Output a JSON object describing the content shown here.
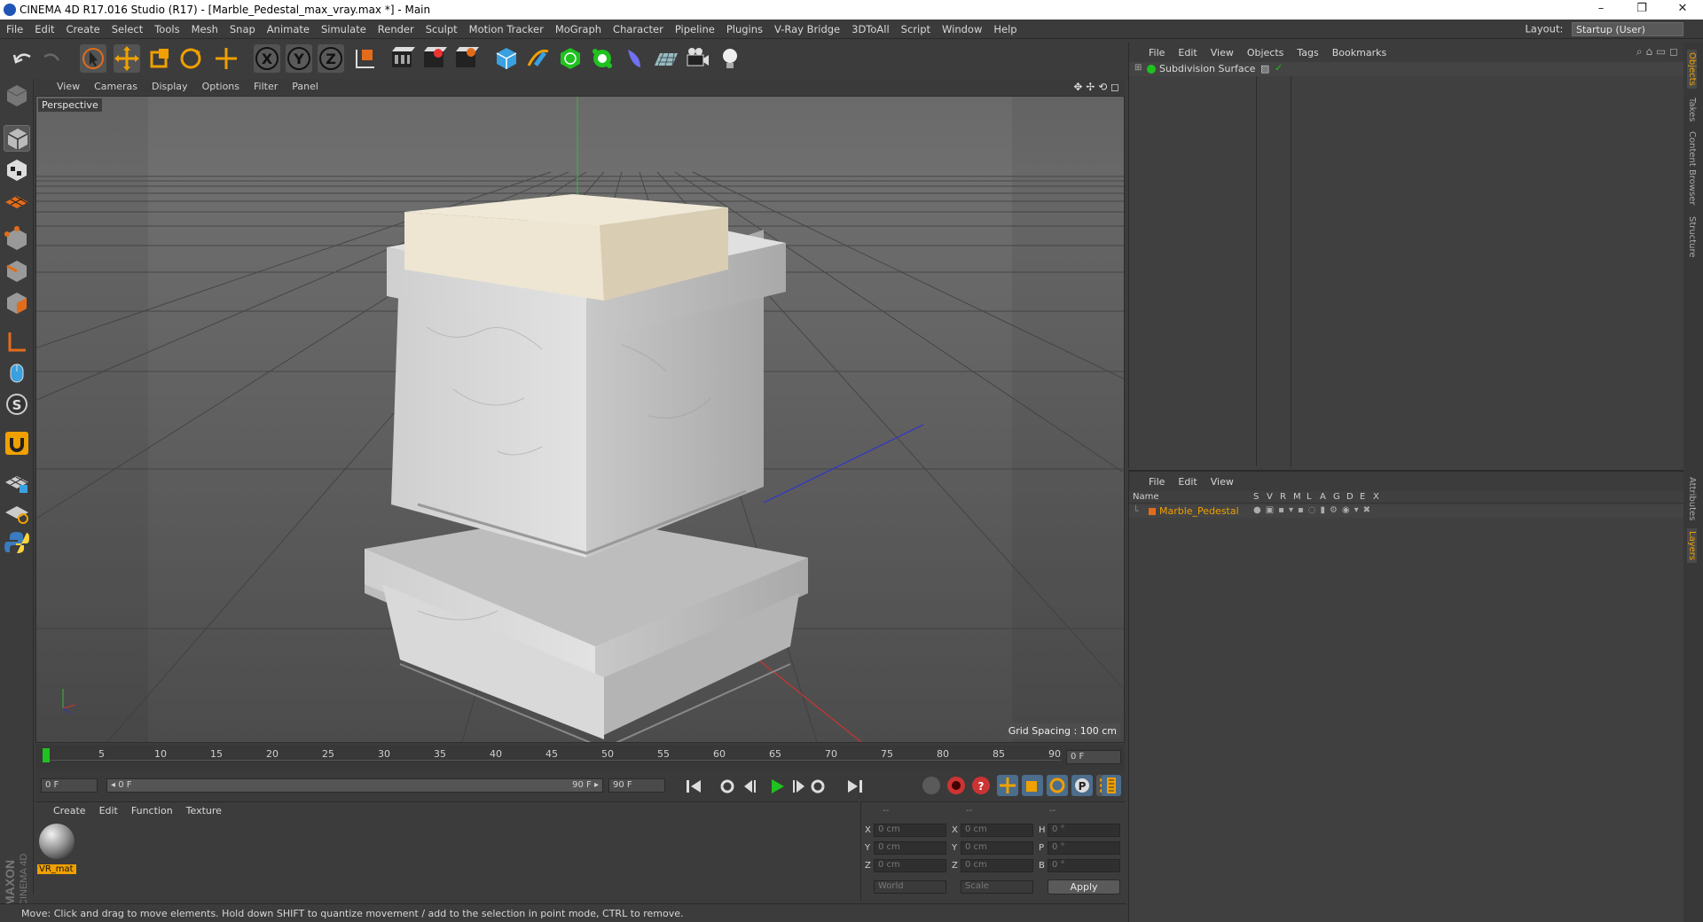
{
  "window": {
    "title": "CINEMA 4D R17.016 Studio (R17) - [Marble_Pedestal_max_vray.max *] - Main",
    "minimize": "–",
    "maximize": "❐",
    "close": "✕"
  },
  "menu": [
    "File",
    "Edit",
    "Create",
    "Select",
    "Tools",
    "Mesh",
    "Snap",
    "Animate",
    "Simulate",
    "Render",
    "Sculpt",
    "Motion Tracker",
    "MoGraph",
    "Character",
    "Pipeline",
    "Plugins",
    "V-Ray Bridge",
    "3DToAll",
    "Script",
    "Window",
    "Help"
  ],
  "layout": {
    "label": "Layout:",
    "value": "Startup (User)"
  },
  "viewport": {
    "menu": [
      "View",
      "Cameras",
      "Display",
      "Options",
      "Filter",
      "Panel"
    ],
    "camera_label": "Perspective",
    "grid_spacing": "Grid Spacing : 100 cm"
  },
  "timeline": {
    "ticks": [
      "0",
      "5",
      "10",
      "15",
      "20",
      "25",
      "30",
      "35",
      "40",
      "45",
      "50",
      "55",
      "60",
      "65",
      "70",
      "75",
      "80",
      "85",
      "90"
    ],
    "current_frame": "0 F",
    "start_field": "0 F",
    "range_start": "◂ 0 F",
    "range_end": "90 F ▸",
    "end_field": "90 F"
  },
  "material_manager": {
    "menu": [
      "Create",
      "Edit",
      "Function",
      "Texture"
    ],
    "material_name": "VR_mat"
  },
  "coordinates": {
    "headers": [
      "--",
      "--",
      "--"
    ],
    "rows": [
      {
        "a": "X",
        "av": "0 cm",
        "b": "X",
        "bv": "0 cm",
        "c": "H",
        "cv": "0 °"
      },
      {
        "a": "Y",
        "av": "0 cm",
        "b": "Y",
        "bv": "0 cm",
        "c": "P",
        "cv": "0 °"
      },
      {
        "a": "Z",
        "av": "0 cm",
        "b": "Z",
        "bv": "0 cm",
        "c": "B",
        "cv": "0 °"
      }
    ],
    "space": "World",
    "mode": "Scale",
    "apply": "Apply"
  },
  "status": "Move: Click and drag to move elements. Hold down SHIFT to quantize movement / add to the selection in point mode, CTRL to remove.",
  "object_manager": {
    "menu": [
      "File",
      "Edit",
      "View",
      "Objects",
      "Tags",
      "Bookmarks"
    ],
    "object": "Subdivision Surface"
  },
  "layer_manager": {
    "menu": [
      "File",
      "Edit",
      "View"
    ],
    "columns": [
      "Name",
      "S",
      "V",
      "R",
      "M",
      "L",
      "A",
      "G",
      "D",
      "E",
      "X"
    ],
    "layer": "Marble_Pedestal"
  },
  "right_tabs": [
    "Objects",
    "Takes",
    "Content Browser",
    "Structure",
    "Attributes",
    "Layers"
  ],
  "brand": "MAXON CINEMA 4D",
  "colors": {
    "accent": "#ff8c00",
    "layer_orange": "#e36c1a",
    "green": "#1fc21f"
  }
}
